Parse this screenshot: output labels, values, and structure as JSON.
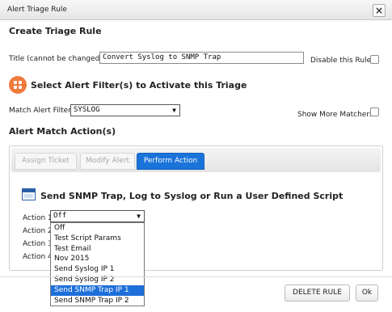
{
  "dialog": {
    "title": "Alert Triage Rule",
    "close_label": "×",
    "heading": "Create Triage Rule"
  },
  "title_field": {
    "label": "Title (cannot be changed):",
    "value": "Convert Syslog to SNMP Trap"
  },
  "disable_rule": {
    "label": "Disable this Rule",
    "checked": false
  },
  "filter_section": {
    "heading": "Select Alert Filter(s) to Activate this Triage"
  },
  "match_filter": {
    "label": "Match Alert Filter",
    "value": "SYSLOG"
  },
  "show_more": {
    "label": "Show More Matchers",
    "checked": false
  },
  "actions_section": {
    "heading": "Alert Match Action(s)"
  },
  "tabs": [
    {
      "label": "Assign Ticket",
      "active": false
    },
    {
      "label": "Modify Alert",
      "active": false
    },
    {
      "label": "Perform Action",
      "active": true
    }
  ],
  "perform_action": {
    "heading": "Send SNMP Trap, Log to Syslog or Run a User Defined Script",
    "action_labels": [
      "Action 1",
      "Action 2",
      "Action 3",
      "Action 4"
    ],
    "action1_value": "Off",
    "dropdown_options": [
      "Off",
      "Test Script Params",
      "Test Email",
      "Nov 2015",
      "Send Syslog IP 1",
      "Send Syslog IP 2",
      "Send SNMP Trap IP 1",
      "Send SNMP Trap IP 2"
    ],
    "highlighted_option": "Send SNMP Trap IP 1"
  },
  "footer": {
    "delete_label": "DELETE RULE",
    "ok_label": "Ok"
  },
  "colors": {
    "accent_blue": "#1a73d9",
    "orange_icon": "#ef7b3c"
  }
}
